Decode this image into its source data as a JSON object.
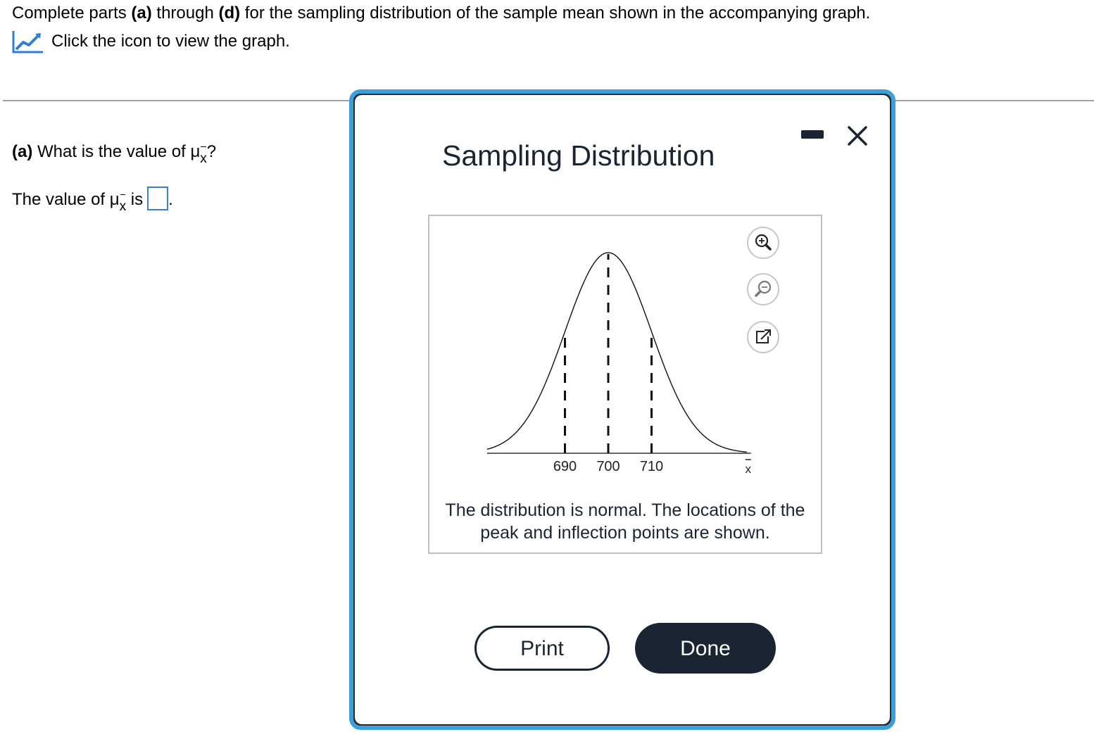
{
  "instruction": {
    "prefix": "Complete parts ",
    "part_a": "(a)",
    "middle": " through ",
    "part_d": "(d)",
    "suffix": " for the sampling distribution of the sample mean shown in the accompanying graph."
  },
  "graph_link": {
    "icon": "line-chart-icon",
    "label": "Click the icon to view the graph."
  },
  "question_a": {
    "label": "(a)",
    "text": " What is the value of ",
    "mu": "μ",
    "sub": "x",
    "end": "?"
  },
  "answer_a": {
    "prefix": "The value of ",
    "mu": "μ",
    "sub": "x",
    "is": " is",
    "value": "",
    "end": "."
  },
  "dialog": {
    "title": "Sampling Distribution",
    "caption_line1": "The distribution is normal. The locations of the",
    "caption_line2": "peak and inflection points are shown.",
    "print_label": "Print",
    "done_label": "Done",
    "icons": [
      "minimize-icon",
      "close-icon",
      "zoom-in-icon",
      "zoom-out-icon",
      "open-external-icon"
    ],
    "colors": {
      "accent": "#3ea0d9",
      "dark": "#1b2433"
    }
  },
  "chart_data": {
    "type": "line",
    "distribution": "normal",
    "mean": 700,
    "sd": 10,
    "x_ticks": [
      690,
      700,
      710
    ],
    "xlabel": "x",
    "xlabel_bar": true,
    "marked_lines": [
      {
        "x": 690,
        "kind": "inflection"
      },
      {
        "x": 700,
        "kind": "peak"
      },
      {
        "x": 710,
        "kind": "inflection"
      }
    ],
    "xlim": [
      672,
      732
    ]
  }
}
